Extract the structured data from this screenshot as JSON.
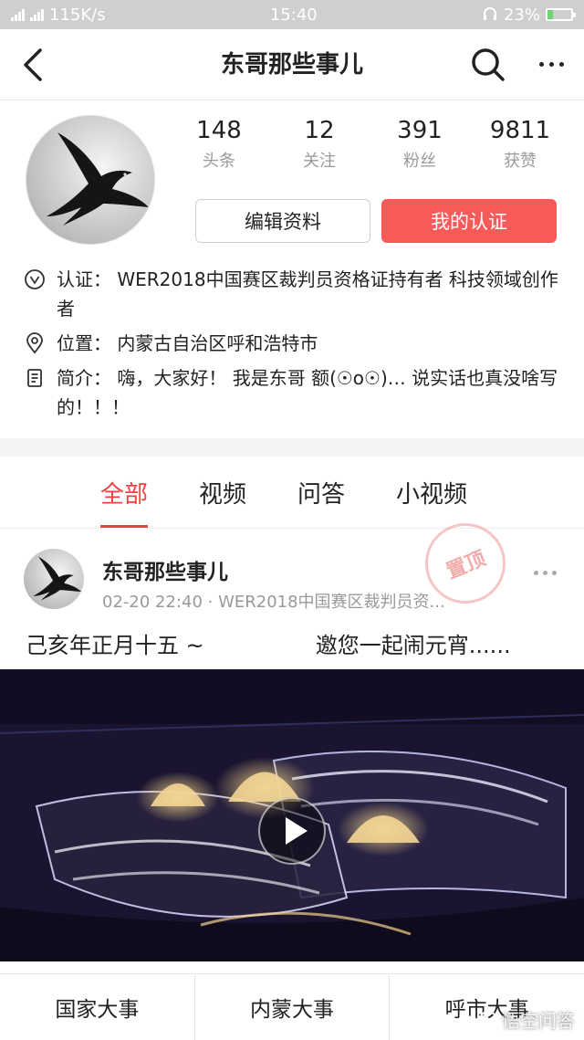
{
  "status_bar": {
    "network": "115K/s",
    "time": "15:40",
    "battery": "23%",
    "battery_level": 0.23,
    "net_top": "2G 4G 4G"
  },
  "nav": {
    "title": "东哥那些事儿",
    "back_icon": "back-icon",
    "search_icon": "search-icon",
    "more_icon": "more-icon"
  },
  "profile": {
    "stats": [
      {
        "value": "148",
        "label": "头条"
      },
      {
        "value": "12",
        "label": "关注"
      },
      {
        "value": "391",
        "label": "粉丝"
      },
      {
        "value": "9811",
        "label": "获赞"
      }
    ],
    "edit_button": "编辑资料",
    "verify_button": "我的认证",
    "info": [
      {
        "icon": "verified-icon",
        "text": "认证：  WER2018中国赛区裁判员资格证持有者 科技领域创作者"
      },
      {
        "icon": "location-icon",
        "text": "位置：  内蒙古自治区呼和浩特市"
      },
      {
        "icon": "document-icon",
        "text": "简介：  嗨，大家好！  我是东哥 额(☉o☉)… 说实话也真没啥写的！！！"
      }
    ]
  },
  "tabs": [
    "全部",
    "视频",
    "问答",
    "小视频"
  ],
  "post": {
    "author": "东哥那些事儿",
    "meta": "02-20 22:40 · WER2018中国赛区裁判员资...",
    "stamp": "置顶",
    "text": "己亥年正月十五 ~                邀您一起闹元宵......"
  },
  "bottom_menu": [
    "国家大事",
    "内蒙大事",
    "呼市大事"
  ],
  "watermark": "悟空问答",
  "colors": {
    "accent": "#f04142",
    "button_red": "#f85959"
  }
}
